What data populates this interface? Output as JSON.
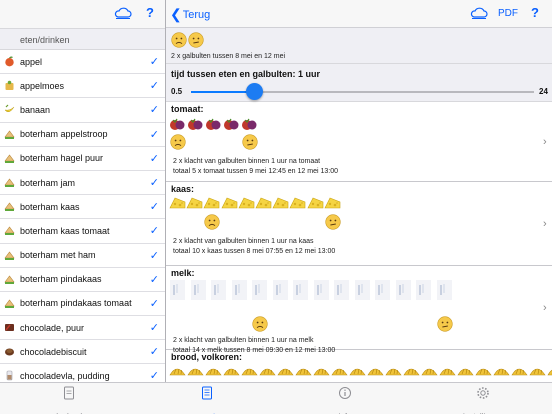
{
  "left": {
    "section_header": "eten/drinken",
    "items": [
      {
        "label": "appel",
        "icon": "apple-icon",
        "color": "#7bb33a",
        "checked": true
      },
      {
        "label": "appelmoes",
        "icon": "applesauce-icon",
        "color": "#e0b23a",
        "checked": true
      },
      {
        "label": "banaan",
        "icon": "banana-icon",
        "color": "#f2d23a",
        "checked": true
      },
      {
        "label": "boterham appelstroop",
        "icon": "sandwich-icon",
        "color": "#c8863a",
        "checked": true
      },
      {
        "label": "boterham hagel puur",
        "icon": "sandwich-icon",
        "color": "#c8863a",
        "checked": true
      },
      {
        "label": "boterham jam",
        "icon": "sandwich-icon",
        "color": "#c8863a",
        "checked": true
      },
      {
        "label": "boterham kaas",
        "icon": "sandwich-icon",
        "color": "#c8863a",
        "checked": true
      },
      {
        "label": "boterham kaas tomaat",
        "icon": "sandwich-icon",
        "color": "#c8863a",
        "checked": true
      },
      {
        "label": "boterham met ham",
        "icon": "sandwich-icon",
        "color": "#c8863a",
        "checked": true
      },
      {
        "label": "boterham pindakaas",
        "icon": "sandwich-icon",
        "color": "#c8863a",
        "checked": true
      },
      {
        "label": "boterham pindakaas tomaat",
        "icon": "sandwich-icon",
        "color": "#c8863a",
        "checked": true
      },
      {
        "label": "chocolade, puur",
        "icon": "chocolate-icon",
        "color": "#7a3a2a",
        "checked": true
      },
      {
        "label": "chocoladebiscuit",
        "icon": "biscuit-icon",
        "color": "#6b3a1f",
        "checked": true
      },
      {
        "label": "chocoladevla, pudding",
        "icon": "pudding-icon",
        "color": "#a0a0a8",
        "checked": true
      }
    ]
  },
  "right": {
    "back_label": "Terug",
    "pdf_label": "PDF",
    "help_label": "?",
    "summary_text": "2 x galbulten tussen 8 mei en 12 mei",
    "slider": {
      "title": "tijd tussen eten en galbulten: 1 uur",
      "min_label": "0.5",
      "max_label": "24",
      "value": 1,
      "min": 0.5,
      "max": 24
    },
    "foods": [
      {
        "name": "tomaat:",
        "icon": "tomato-icon",
        "count": 5,
        "line1": "2 x  klacht van galbulten binnen 1 uur na tomaat",
        "line2": "totaal 5 x tomaat tussen 9 mei 12:45 en 12 mei 13:00"
      },
      {
        "name": "kaas:",
        "icon": "cheese-icon",
        "count": 10,
        "line1": "2 x  klacht van galbulten binnen 1 uur na kaas",
        "line2": "totaal 10 x kaas tussen 8 mei 07:55 en 12 mei 13:00"
      },
      {
        "name": "melk:",
        "icon": "milk-icon",
        "count": 14,
        "line1": "2 x  klacht van galbulten binnen 1 uur na melk",
        "line2": "totaal 14 x melk tussen 8 mei 09:30 en 12 mei 13:00"
      },
      {
        "name": "brood, volkoren:",
        "icon": "bread-icon",
        "count": 22
      }
    ]
  },
  "tabs": [
    {
      "label": "dagboek",
      "icon": "diary-icon",
      "active": false
    },
    {
      "label": "rapporten",
      "icon": "reports-icon",
      "active": true
    },
    {
      "label": "info",
      "icon": "info-icon",
      "active": false
    },
    {
      "label": "instellingen",
      "icon": "settings-icon",
      "active": false
    }
  ],
  "colors": {
    "accent": "#0a60ff",
    "slider": "#1d7cf2"
  },
  "left_help_label": "?"
}
